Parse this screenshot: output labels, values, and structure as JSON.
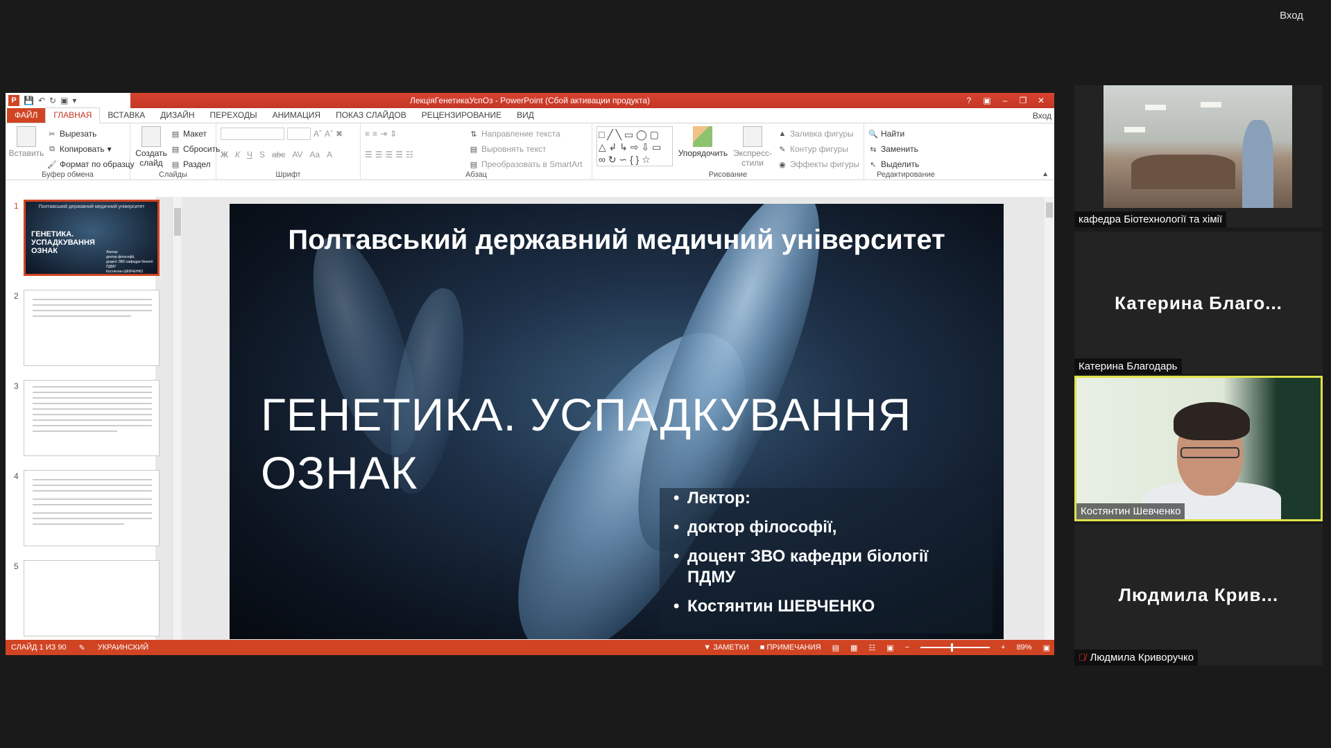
{
  "top": {
    "signin_label": "Вход"
  },
  "ppt": {
    "window_title": "ЛекціяГенетикаУспОз - PowerPoint (Сбой активации продукта)",
    "help": "?",
    "tabs": [
      "ФАЙЛ",
      "ГЛАВНАЯ",
      "ВСТАВКА",
      "ДИЗАЙН",
      "ПЕРЕХОДЫ",
      "АНИМАЦИЯ",
      "ПОКАЗ СЛАЙДОВ",
      "РЕЦЕНЗИРОВАНИЕ",
      "ВИД"
    ],
    "login": "Вход",
    "ribbon": {
      "clipboard": {
        "paste": "Вставить",
        "cut": "Вырезать",
        "copy": "Копировать",
        "format": "Формат по образцу",
        "label": "Буфер обмена"
      },
      "slides": {
        "new": "Создать слайд",
        "layout": "Макет",
        "reset": "Сбросить",
        "section": "Раздел",
        "label": "Слайды"
      },
      "font": {
        "label": "Шрифт",
        "bold": "Ж",
        "italic": "К",
        "underline": "Ч",
        "shadow": "S",
        "strike": "abc",
        "spacing": "AV",
        "case": "Aa",
        "color": "A"
      },
      "paragraph": {
        "direction": "Направление текста",
        "align": "Выровнять текст",
        "smartart": "Преобразовать в SmartArt",
        "label": "Абзац"
      },
      "drawing": {
        "arrange": "Упорядочить",
        "quickstyles": "Экспресс-стили",
        "fill": "Заливка фигуры",
        "outline": "Контур фигуры",
        "effects": "Эффекты фигуры",
        "label": "Рисование"
      },
      "editing": {
        "find": "Найти",
        "replace": "Заменить",
        "select": "Выделить",
        "label": "Редактирование"
      }
    },
    "thumbs": [
      "1",
      "2",
      "3",
      "4",
      "5"
    ],
    "thumb1": {
      "uni": "Полтавський державний медичний університет",
      "title": "ГЕНЕТИКА. УСПАДКУВАННЯ ОЗНАК",
      "lines": [
        "Лектор:",
        "доктор філософії,",
        "доцент ЗВО кафедри біології ПДМУ",
        "Костянтин ШЕВЧЕНКО"
      ]
    },
    "slide": {
      "uni": "Полтавський державний медичний університет",
      "title_line1": "ГЕНЕТИКА. УСПАДКУВАННЯ",
      "title_line2": "ОЗНАК",
      "bullets": [
        "Лектор:",
        "доктор філософії,",
        "доцент ЗВО кафедри біології",
        "ПДМУ",
        "Костянтин ШЕВЧЕНКО"
      ]
    },
    "status": {
      "slide": "СЛАЙД 1 ИЗ 90",
      "lang": "УКРАИНСКИЙ",
      "notes": "ЗАМЕТКИ",
      "comments": "ПРИМЕЧАНИЯ",
      "zoom": "89%",
      "minus": "−",
      "plus": "+"
    }
  },
  "participants": [
    {
      "name": "кафедра Біотехнології та хімії"
    },
    {
      "big": "Катерина  Благо...",
      "name": "Катерина Благодарь"
    },
    {
      "name": "Костянтин Шевченко"
    },
    {
      "big": "Людмила  Крив...",
      "name": "Людмила Криворучко"
    }
  ],
  "colors": {
    "accent": "#d04423",
    "speaker_highlight": "#e0e34a"
  }
}
